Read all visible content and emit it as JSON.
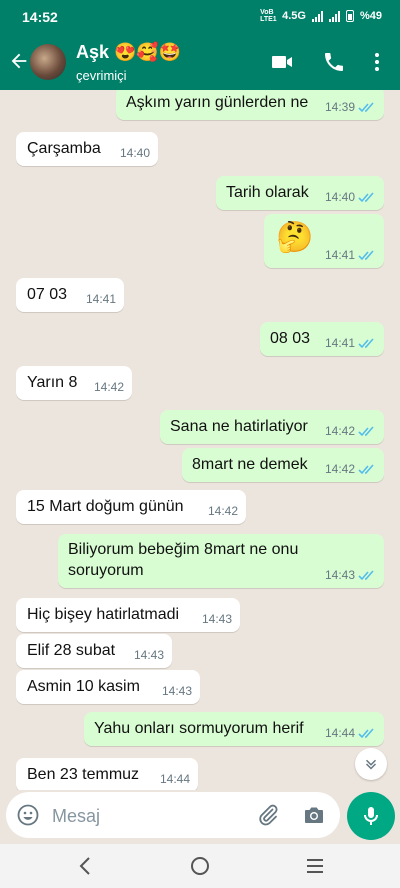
{
  "status_bar": {
    "time": "14:52",
    "network": "4.5G",
    "volte": "VoB LTE1",
    "battery": "%49"
  },
  "header": {
    "contact_name": "Aşk 😍🥰🤩",
    "status": "çevrimiçi"
  },
  "messages": [
    {
      "dir": "out",
      "text": "Aşkım yarın günlerden ne",
      "time": "14:39"
    },
    {
      "dir": "in",
      "text": "Çarşamba",
      "time": "14:40"
    },
    {
      "dir": "out",
      "text": "Tarih olarak",
      "time": "14:40"
    },
    {
      "dir": "out",
      "text": "🤔",
      "time": "14:41"
    },
    {
      "dir": "in",
      "text": "07 03",
      "time": "14:41"
    },
    {
      "dir": "out",
      "text": "08 03",
      "time": "14:41"
    },
    {
      "dir": "in",
      "text": "Yarın 8",
      "time": "14:42"
    },
    {
      "dir": "out",
      "text": "Sana ne hatirlatiyor",
      "time": "14:42"
    },
    {
      "dir": "out",
      "text": "8mart ne demek",
      "time": "14:42"
    },
    {
      "dir": "in",
      "text": "15 Mart doğum günün",
      "time": "14:42"
    },
    {
      "dir": "out",
      "text_line1": "Biliyorum bebeğim 8mart ne onu",
      "text_line2": "soruyorum",
      "time": "14:43"
    },
    {
      "dir": "in",
      "text": "Hiç bişey hatirlatmadi",
      "time": "14:43"
    },
    {
      "dir": "in",
      "text": "Elif 28 subat",
      "time": "14:43"
    },
    {
      "dir": "in",
      "text": "Asmin 10 kasim",
      "time": "14:43"
    },
    {
      "dir": "out",
      "text": "Yahu onları sormuyorum herif",
      "time": "14:44"
    },
    {
      "dir": "in",
      "text": "Ben 23 temmuz",
      "time": "14:44"
    }
  ],
  "composer": {
    "placeholder": "Mesaj"
  },
  "colors": {
    "header": "#008069",
    "outgoing": "#d9fdd3",
    "incoming": "#ffffff",
    "read_ticks": "#53bdeb",
    "fab": "#00a884"
  },
  "icons": [
    "back-arrow-icon",
    "video-call-icon",
    "phone-icon",
    "more-vert-icon",
    "emoji-icon",
    "attach-icon",
    "camera-icon",
    "mic-icon",
    "scroll-down-icon"
  ]
}
